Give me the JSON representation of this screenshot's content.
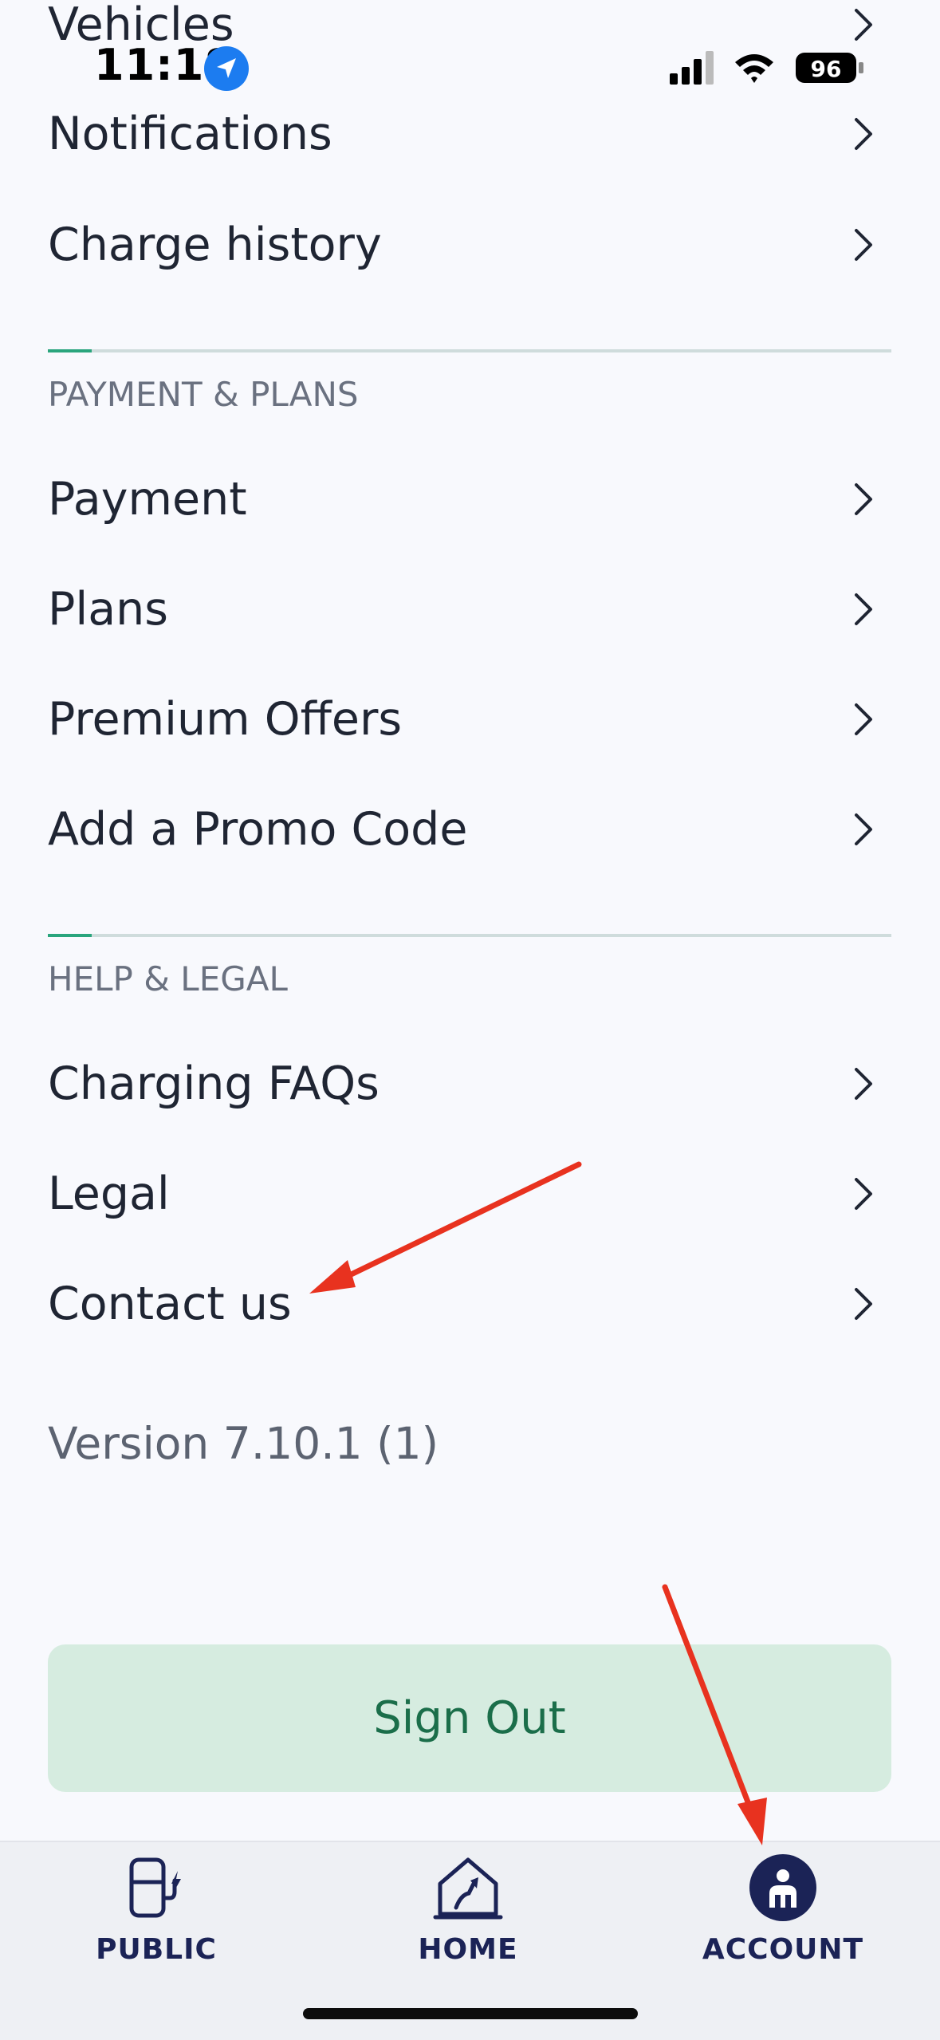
{
  "status_bar": {
    "time": "11:18",
    "battery": "96"
  },
  "menu": {
    "vehicles": "Vehicles",
    "notifications": "Notifications",
    "charge_history": "Charge history",
    "payment_section": "PAYMENT & PLANS",
    "payment": "Payment",
    "plans": "Plans",
    "premium_offers": "Premium Offers",
    "promo_code": "Add a Promo Code",
    "help_section": "HELP & LEGAL",
    "charging_faqs": "Charging FAQs",
    "legal": "Legal",
    "contact_us": "Contact us"
  },
  "version": "Version 7.10.1 (1)",
  "sign_out": "Sign Out",
  "tabs": {
    "public": "PUBLIC",
    "home": "HOME",
    "account": "ACCOUNT"
  },
  "colors": {
    "accent_green": "#2aa57d",
    "signout_bg": "#d6ece0",
    "signout_text": "#1b6e4a",
    "nav_blue": "#1b2356",
    "annotation_red": "#e8321f"
  }
}
